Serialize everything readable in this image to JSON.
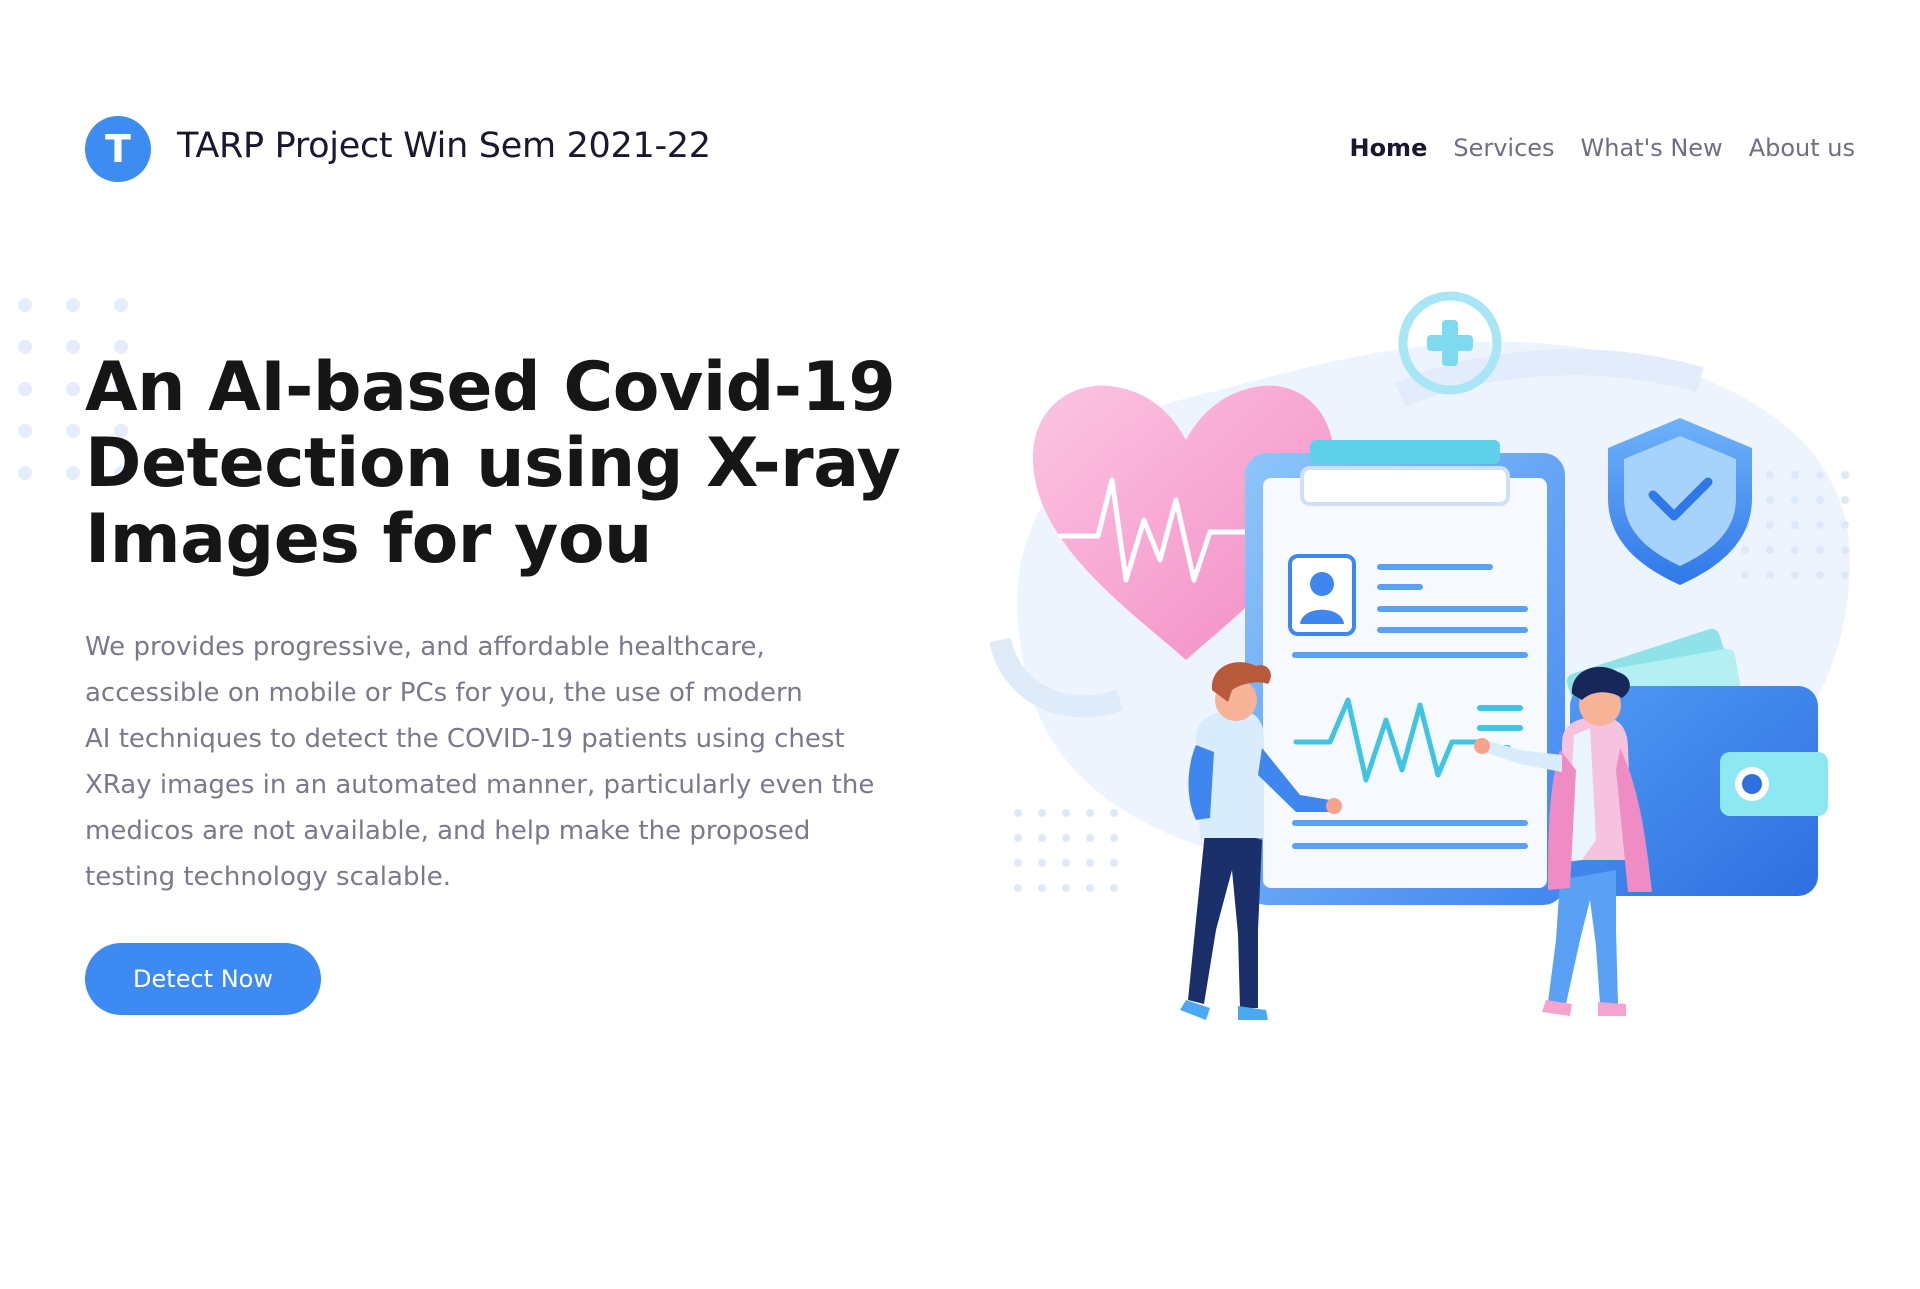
{
  "header": {
    "logo_letter": "T",
    "title": "TARP Project Win Sem 2021-22"
  },
  "nav": {
    "items": [
      {
        "label": "Home",
        "active": true
      },
      {
        "label": "Services",
        "active": false
      },
      {
        "label": "What's New",
        "active": false
      },
      {
        "label": "About us",
        "active": false
      }
    ]
  },
  "hero": {
    "title_lines": [
      "An AI-based Covid-19",
      "Detection using X-ray",
      "Images for you"
    ],
    "description_lines": [
      "We provides progressive, and affordable healthcare,",
      "accessible on mobile or PCs for you, the use of modern",
      "AI techniques to detect the COVID-19 patients using chest",
      "XRay images in an automated manner, particularly even the",
      "medicos are not available, and help make the proposed",
      "testing technology scalable."
    ],
    "cta_label": "Detect Now"
  },
  "colors": {
    "accent": "#3d8af2",
    "heading": "#161616",
    "body_text": "#797a8c",
    "nav_text": "#6e6f82",
    "heart_pink": "#f7a6d0"
  },
  "icons": [
    "medical-plus-icon",
    "heart-pulse-icon",
    "shield-check-icon",
    "patient-profile-icon",
    "wallet-icon"
  ]
}
